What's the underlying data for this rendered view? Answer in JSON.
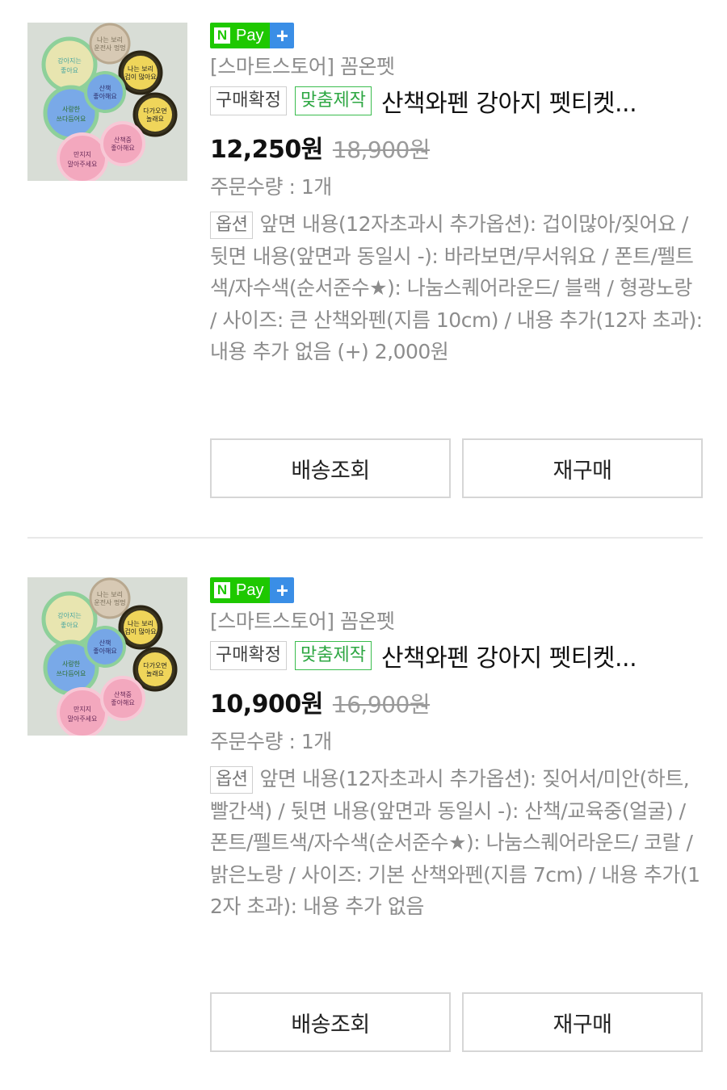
{
  "orders": [
    {
      "npay": {
        "n": "N",
        "pay": "Pay",
        "plus": "+"
      },
      "store": "[스마트스토어] 꼼온펫",
      "status_tag": "구매확정",
      "custom_tag": "맞춤제작",
      "title": "산책와펜 강아지 펫티켓...",
      "price": "12,250원",
      "original_price": "18,900원",
      "quantity": "주문수량 : 1개",
      "option_tag": "옵션",
      "option_text": "앞면 내용(12자초과시 추가옵션): 겁이많아/짖어요 / 뒷면 내용(앞면과 동일시 -): 바라보면/무서워요 / 폰트/펠트색/자수색(순서준수★): 나눔스퀘어라운드/ 블랙 / 형광노랑 / 사이즈: 큰 산책와펜(지름 10cm) / 내용 추가(12자 초과): 내용 추가 없음 (+) 2,000원",
      "buttons": {
        "track": "배송조회",
        "rebuy": "재구매"
      }
    },
    {
      "npay": {
        "n": "N",
        "pay": "Pay",
        "plus": "+"
      },
      "store": "[스마트스토어] 꼼온펫",
      "status_tag": "구매확정",
      "custom_tag": "맞춤제작",
      "title": "산책와펜 강아지 펫티켓...",
      "price": "10,900원",
      "original_price": "16,900원",
      "quantity": "주문수량 : 1개",
      "option_tag": "옵션",
      "option_text": "앞면 내용(12자초과시 추가옵션): 짖어서/미안(하트,빨간색) / 뒷면 내용(앞면과 동일시 -): 산책/교육중(얼굴) / 폰트/펠트색/자수색(순서준수★): 나눔스퀘어라운드/ 코랄 / 밝은노랑 / 사이즈: 기본 산책와펜(지름 7cm) / 내용 추가(12자 초과): 내용 추가 없음",
      "buttons": {
        "track": "배송조회",
        "rebuy": "재구매"
      }
    }
  ],
  "thumbnail_patches": [
    {
      "line1": "강아지는",
      "line2": "좋아요"
    },
    {
      "line1": "나는 보리",
      "line2": "운전사 멍멍"
    },
    {
      "line1": "나는 보리",
      "line2": "겁이 많아요"
    },
    {
      "line1": "사랑한",
      "line2": "쓰다듬어요"
    },
    {
      "line1": "산책",
      "line2": "좋아해요"
    },
    {
      "line1": "다가오면",
      "line2": "놀래요"
    },
    {
      "line1": "만지지",
      "line2": "말아주세요"
    },
    {
      "line1": "산책중",
      "line2": "좋아해요"
    }
  ],
  "colors": {
    "npay_green": "#1ec800",
    "npay_blue": "#3a8ee6",
    "custom_tag_green": "#2ea743",
    "muted_text": "#8c8c8c",
    "border": "#d6d6d6"
  }
}
